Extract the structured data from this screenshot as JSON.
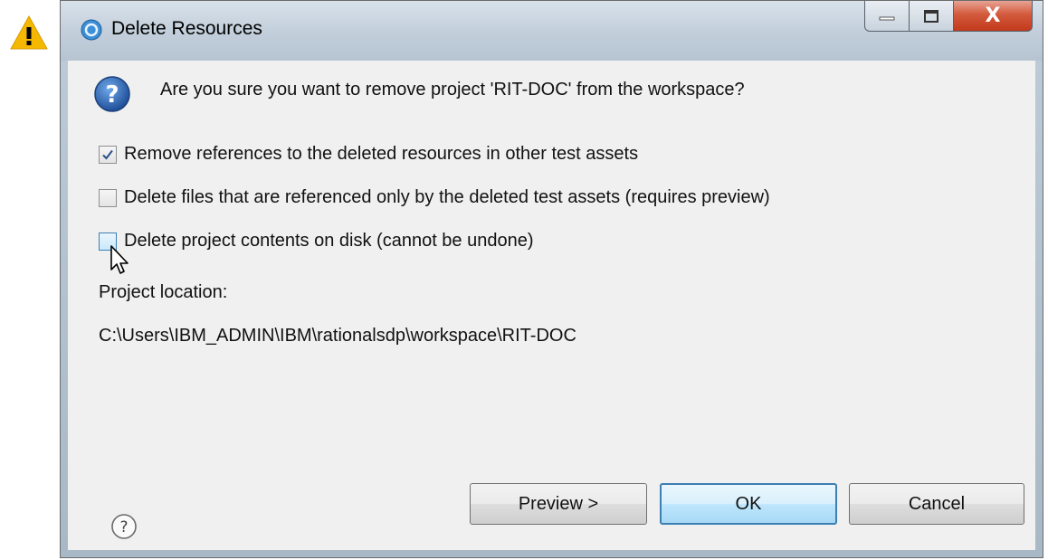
{
  "window": {
    "title": "Delete Resources",
    "controls": {
      "minimize": "minimize",
      "maximize": "maximize",
      "close": "X"
    }
  },
  "dialog": {
    "message": "Are you sure you want to remove project 'RIT-DOC' from the workspace?",
    "options": [
      {
        "label": "Remove references to the deleted resources in other test assets",
        "checked": true
      },
      {
        "label": "Delete files that are referenced only by the deleted test assets (requires preview)",
        "checked": false
      },
      {
        "label": "Delete project contents on disk (cannot be undone)",
        "checked": false
      }
    ],
    "location_label": "Project location:",
    "location_path": "C:\\Users\\IBM_ADMIN\\IBM\\rationalsdp\\workspace\\RIT-DOC"
  },
  "buttons": {
    "preview": "Preview >",
    "ok": "OK",
    "cancel": "Cancel"
  },
  "icons": {
    "warning": "warning-icon",
    "app": "app-icon",
    "question": "question-icon",
    "help": "help-icon",
    "cursor": "cursor-icon"
  },
  "colors": {
    "warning": "#f5b800",
    "question_blue": "#1f5fb0",
    "close_red": "#c9452a"
  }
}
